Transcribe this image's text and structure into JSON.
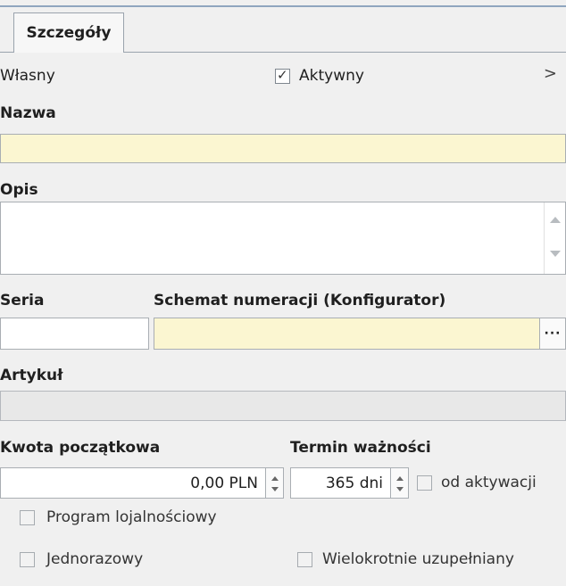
{
  "tabs": [
    {
      "label": "Szczegóły"
    }
  ],
  "row1": {
    "left_label": "Własny",
    "active_label": "Aktywny",
    "chevron": ">"
  },
  "nazwa": {
    "label": "Nazwa",
    "value": ""
  },
  "opis": {
    "label": "Opis",
    "value": ""
  },
  "seria": {
    "label": "Seria",
    "value": ""
  },
  "schemat": {
    "label": "Schemat numeracji (Konfigurator)",
    "value": "",
    "button": "···"
  },
  "artykul": {
    "label": "Artykuł",
    "value": ""
  },
  "kwota": {
    "label": "Kwota początkowa",
    "value": "0,00 PLN"
  },
  "termin": {
    "label": "Termin ważności",
    "value": "365 dni",
    "checkbox_label": "od aktywacji"
  },
  "checkboxes": {
    "program": "Program lojalnościowy",
    "jednorazowy": "Jednorazowy",
    "wielokrotnie": "Wielokrotnie uzupełniany"
  },
  "states": {
    "aktywny": true,
    "od_aktywacji": false,
    "program": false,
    "jednorazowy": false,
    "wielokrotnie": false
  }
}
